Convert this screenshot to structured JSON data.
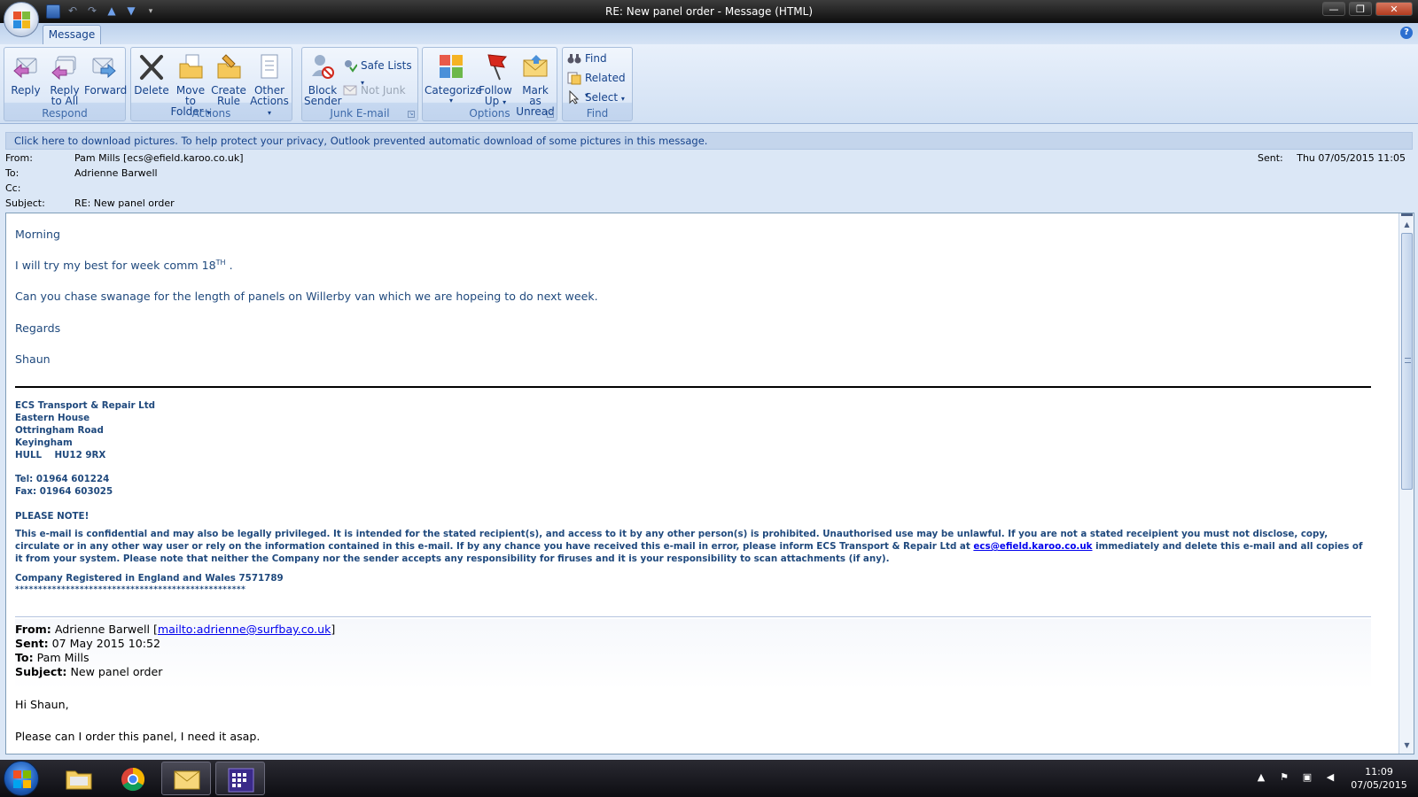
{
  "window": {
    "title": "RE: New panel order  -  Message (HTML)",
    "tab": "Message",
    "help_icon": "?"
  },
  "ribbon": {
    "respond": {
      "label": "Respond",
      "reply": "Reply",
      "reply_all_1": "Reply",
      "reply_all_2": "to All",
      "forward": "Forward"
    },
    "actions": {
      "label": "Actions",
      "delete": "Delete",
      "move_1": "Move to",
      "move_2": "Folder",
      "rule_1": "Create",
      "rule_2": "Rule",
      "other_1": "Other",
      "other_2": "Actions"
    },
    "junk": {
      "label": "Junk E-mail",
      "block_1": "Block",
      "block_2": "Sender",
      "safe_lists": "Safe Lists",
      "not_junk": "Not Junk"
    },
    "options": {
      "label": "Options",
      "categorize": "Categorize",
      "follow_1": "Follow",
      "follow_2": "Up",
      "mark_1": "Mark as",
      "mark_2": "Unread"
    },
    "find": {
      "label": "Find",
      "find": "Find",
      "related": "Related",
      "select": "Select"
    }
  },
  "infobar": "Click here to download pictures. To help protect your privacy, Outlook prevented automatic download of some pictures in this message.",
  "header": {
    "from_label": "From:",
    "from": "Pam Mills [ecs@efield.karoo.co.uk]",
    "to_label": "To:",
    "to": "Adrienne Barwell",
    "cc_label": "Cc:",
    "cc": "",
    "subject_label": "Subject:",
    "subject": "RE: New panel order",
    "sent_label": "Sent:",
    "sent": "Thu 07/05/2015 11:05"
  },
  "message": {
    "greeting": "Morning",
    "line1": "I will try my best for week comm 18",
    "line1_sup": "TH",
    "line1_end": " .",
    "line2": "Can you chase swanage for the length of panels on Willerby van which we are hopeing to do next week.",
    "regards": "Regards",
    "name": "Shaun"
  },
  "signature": {
    "company": "ECS Transport & Repair Ltd",
    "addr1": "Eastern House",
    "addr2": "Ottringham Road",
    "addr3": "Keyingham",
    "addr4": "HULL    HU12 9RX",
    "tel": "Tel: 01964 601224",
    "fax": "Fax: 01964 603025",
    "note_title": "PLEASE NOTE!",
    "disclaimer_a": "This e-mail is confidential and may also be legally privileged.  It is intended for the stated recipient(s), and access to it by any other person(s) is prohibited.  Unauthorised use may be unlawful.  If you are not a stated receipient you must not disclose, copy, circulate or in any other way user or rely on the information contained in this e-mail.  If by any chance you have received this e-mail in error, please inform ECS Transport & Repair Ltd at ",
    "disclaimer_link": "ecs@efield.karoo.co.uk",
    "disclaimer_b": " immediately and delete this e-mail and all copies of it from your system.  Please note that neither the Company nor the sender accepts any responsibility for firuses and it is your responsibility to scan attachments (if any).",
    "registered": "Company Registered in England and Wales 7571789",
    "stars": "**************************************************"
  },
  "quoted": {
    "from_label": "From:",
    "from_name": " Adrienne Barwell [",
    "from_link": "mailto:adrienne@surfbay.co.uk",
    "from_end": "]",
    "sent_label": "Sent:",
    "sent": " 07 May 2015 10:52",
    "to_label": "To:",
    "to": " Pam Mills",
    "subject_label": "Subject:",
    "subject": " New panel order",
    "greeting": "Hi Shaun,",
    "body": "Please can I order this panel, I need it asap."
  },
  "taskbar": {
    "time": "11:09",
    "date": "07/05/2015"
  },
  "colors": {
    "accent": "#15428b",
    "body_text": "#1f497d",
    "link": "#0000ee"
  }
}
